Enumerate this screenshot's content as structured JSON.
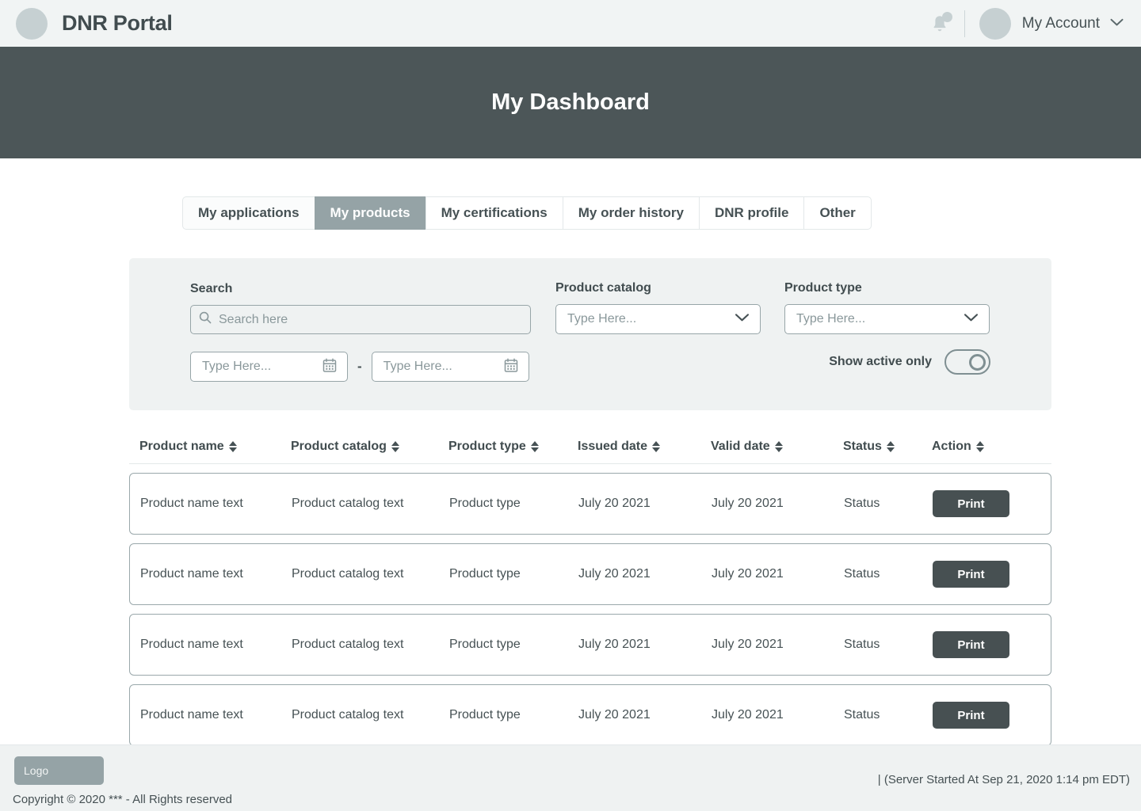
{
  "header": {
    "brand_title": "DNR Portal",
    "logo_icon": "circle-logo-icon",
    "bell_icon": "notification-bell-icon",
    "avatar_icon": "user-avatar-icon",
    "account_label": "My Account",
    "chevron_icon": "chevron-down-icon",
    "background": "#f1f4f4"
  },
  "banner": {
    "title": "My Dashboard",
    "background": "#4c5658"
  },
  "tabs": [
    {
      "label": "My applications",
      "active": false
    },
    {
      "label": "My products",
      "active": true
    },
    {
      "label": "My certifications",
      "active": false
    },
    {
      "label": "My order history",
      "active": false
    },
    {
      "label": "DNR profile",
      "active": false
    },
    {
      "label": "Other",
      "active": false
    }
  ],
  "filters": {
    "background": "#eff2f2",
    "search": {
      "label": "Search",
      "placeholder": "Search here",
      "value": "",
      "icon": "search-icon"
    },
    "product_catalog": {
      "label": "Product catalog",
      "placeholder": "Type Here...",
      "value": "",
      "icon": "chevron-down-icon"
    },
    "product_type": {
      "label": "Product type",
      "placeholder": "Type Here...",
      "value": "",
      "icon": "chevron-down-icon"
    },
    "date_from": {
      "placeholder": "Type Here...",
      "value": "",
      "icon": "calendar-icon"
    },
    "date_separator": "-",
    "date_to": {
      "placeholder": "Type Here...",
      "value": "",
      "icon": "calendar-icon"
    },
    "show_active_only": {
      "label": "Show active only",
      "state": "on"
    }
  },
  "table": {
    "columns": [
      {
        "label": "Product name",
        "sort_icon": "sort-icon"
      },
      {
        "label": "Product catalog",
        "sort_icon": "sort-icon"
      },
      {
        "label": "Product type",
        "sort_icon": "sort-icon"
      },
      {
        "label": "Issued date",
        "sort_icon": "sort-icon"
      },
      {
        "label": "Valid date",
        "sort_icon": "sort-icon"
      },
      {
        "label": "Status",
        "sort_icon": "sort-icon"
      },
      {
        "label": "Action",
        "sort_icon": "sort-icon"
      }
    ],
    "rows": [
      {
        "product_name": "Product name text",
        "product_catalog": "Product catalog text",
        "product_type": "Product type",
        "issued_date": "July 20 2021",
        "valid_date": "July 20 2021",
        "status": "Status",
        "action": "Print"
      },
      {
        "product_name": "Product name text",
        "product_catalog": "Product catalog text",
        "product_type": "Product type",
        "issued_date": "July 20 2021",
        "valid_date": "July 20 2021",
        "status": "Status",
        "action": "Print"
      },
      {
        "product_name": "Product name text",
        "product_catalog": "Product catalog text",
        "product_type": "Product type",
        "issued_date": "July 20 2021",
        "valid_date": "July 20 2021",
        "status": "Status",
        "action": "Print"
      },
      {
        "product_name": "Product name text",
        "product_catalog": "Product catalog text",
        "product_type": "Product type",
        "issued_date": "July 20 2021",
        "valid_date": "July 20 2021",
        "status": "Status",
        "action": "Print"
      }
    ]
  },
  "footer": {
    "logo_label": "Logo",
    "copyright": "Copyright © 2020 *** - All Rights reserved",
    "server_info": "| (Server Started At Sep 21, 2020 1:14 pm EDT)"
  }
}
